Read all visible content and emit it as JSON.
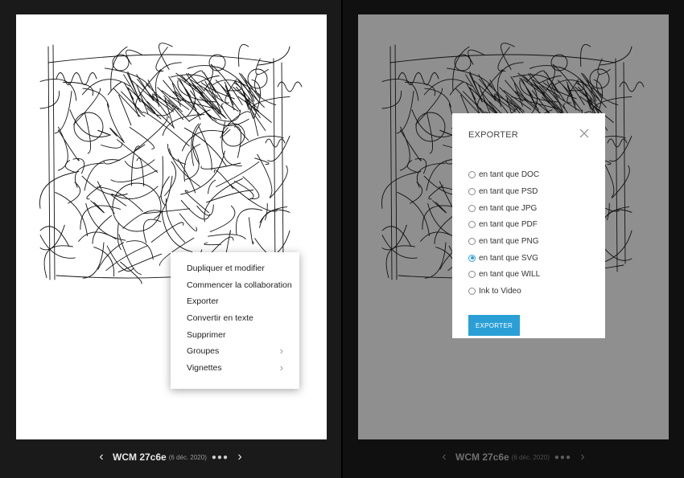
{
  "left_view": {
    "context_menu": {
      "items": [
        {
          "label": "Dupliquer et modifier",
          "has_submenu": false
        },
        {
          "label": "Commencer la collaboration",
          "has_submenu": false
        },
        {
          "label": "Exporter",
          "has_submenu": false
        },
        {
          "label": "Convertir en texte",
          "has_submenu": false
        },
        {
          "label": "Supprimer",
          "has_submenu": false
        },
        {
          "label": "Groupes",
          "has_submenu": true
        },
        {
          "label": "Vignettes",
          "has_submenu": true
        }
      ],
      "chevron": "›"
    },
    "footer": {
      "prev": "‹",
      "doc_name": "WCM 27c6e",
      "doc_date": "(6 déc. 2020)",
      "more": "●●●",
      "next": "›"
    }
  },
  "right_view": {
    "export_dialog": {
      "title": "EXPORTER",
      "options": [
        {
          "label": "en tant que DOC",
          "selected": false
        },
        {
          "label": "en tant que PSD",
          "selected": false
        },
        {
          "label": "en tant que JPG",
          "selected": false
        },
        {
          "label": "en tant que PDF",
          "selected": false
        },
        {
          "label": "en tant que PNG",
          "selected": false
        },
        {
          "label": "en tant que SVG",
          "selected": true
        },
        {
          "label": "en tant que WILL",
          "selected": false
        },
        {
          "label": "Ink to Video",
          "selected": false
        }
      ],
      "export_button": "Exporter"
    },
    "footer": {
      "prev": "‹",
      "doc_name": "WCM 27c6e",
      "doc_date": "(6 déc. 2020)",
      "more": "●●●",
      "next": "›"
    }
  },
  "colors": {
    "accent": "#2a9fd6",
    "dimmed_overlay": "#8f8f8f",
    "page": "#ffffff"
  }
}
